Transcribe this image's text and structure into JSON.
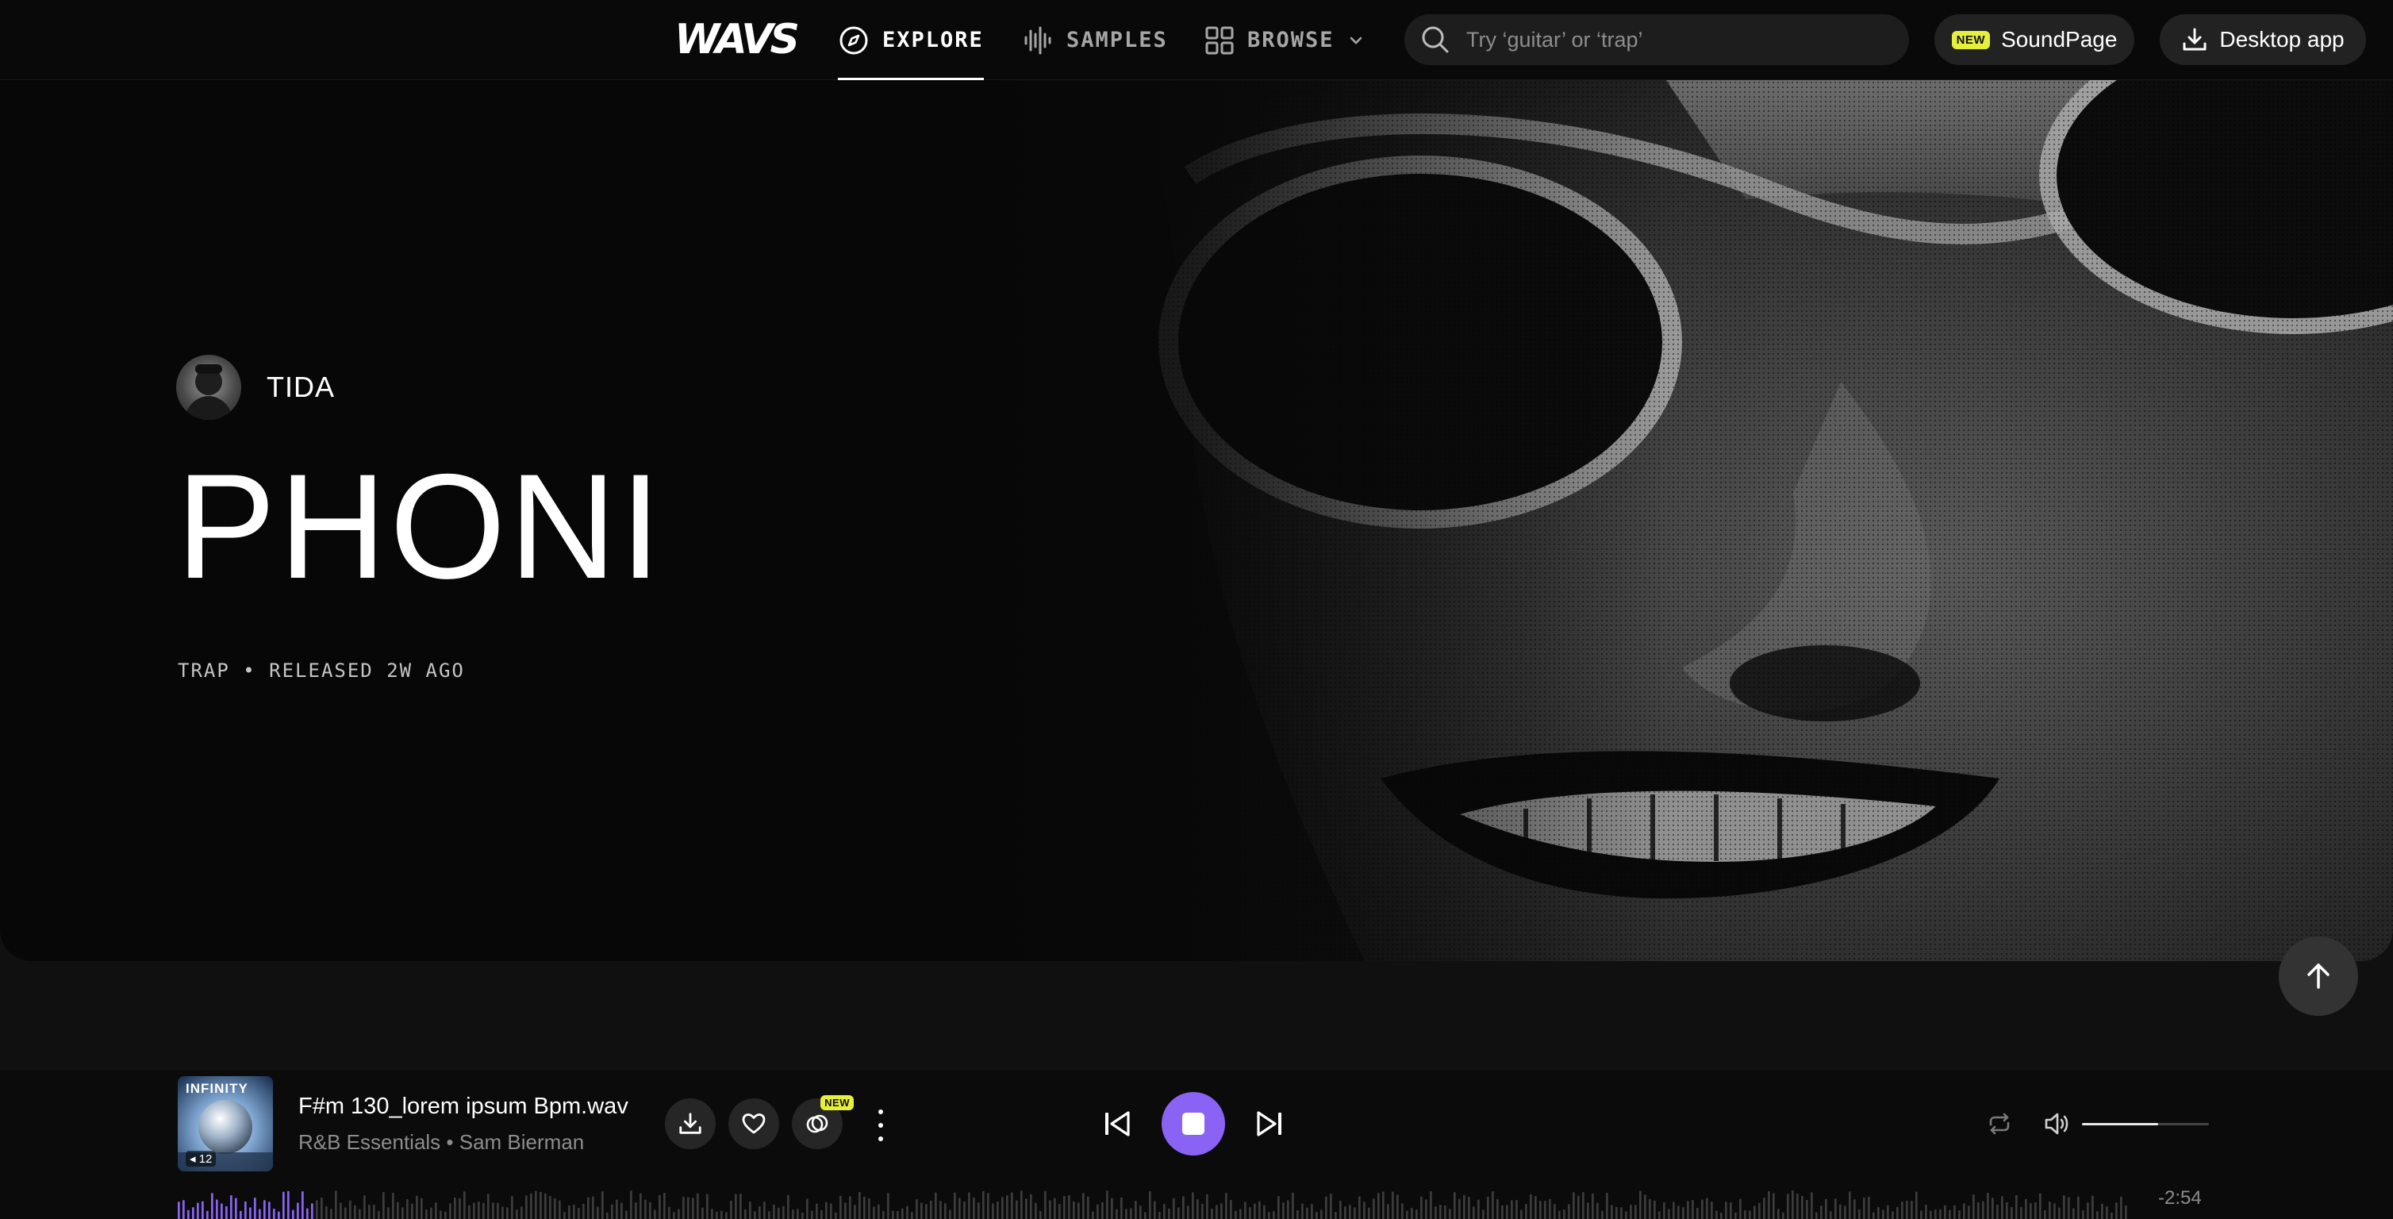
{
  "nav": {
    "logo": "WAVS",
    "tabs": [
      {
        "label": "EXPLORE",
        "active": true,
        "icon": "compass-icon"
      },
      {
        "label": "SAMPLES",
        "active": false,
        "icon": "waveform-icon"
      },
      {
        "label": "BROWSE",
        "active": false,
        "icon": "grid-icon"
      }
    ],
    "search_placeholder": "Try ‘guitar’ or ‘trap’",
    "soundpage_badge": "NEW",
    "soundpage_label": "SoundPage",
    "desktop_label": "Desktop app"
  },
  "hero": {
    "artist": "TIDA",
    "title": "PHONI",
    "meta": "TRAP • RELEASED 2W AGO"
  },
  "player": {
    "cover_label": "INFINITY",
    "cover_count": "12",
    "track_title": "F#m 130_lorem ipsum Bpm.wav",
    "track_pack": "R&B Essentials",
    "track_artist": "Sam Bierman",
    "stems_badge": "NEW",
    "time_remaining": "-2:54",
    "volume": 0.6,
    "progress": 0.07
  },
  "colors": {
    "accent": "#8a63f5",
    "badge": "#e6f03b",
    "background": "#101010"
  }
}
